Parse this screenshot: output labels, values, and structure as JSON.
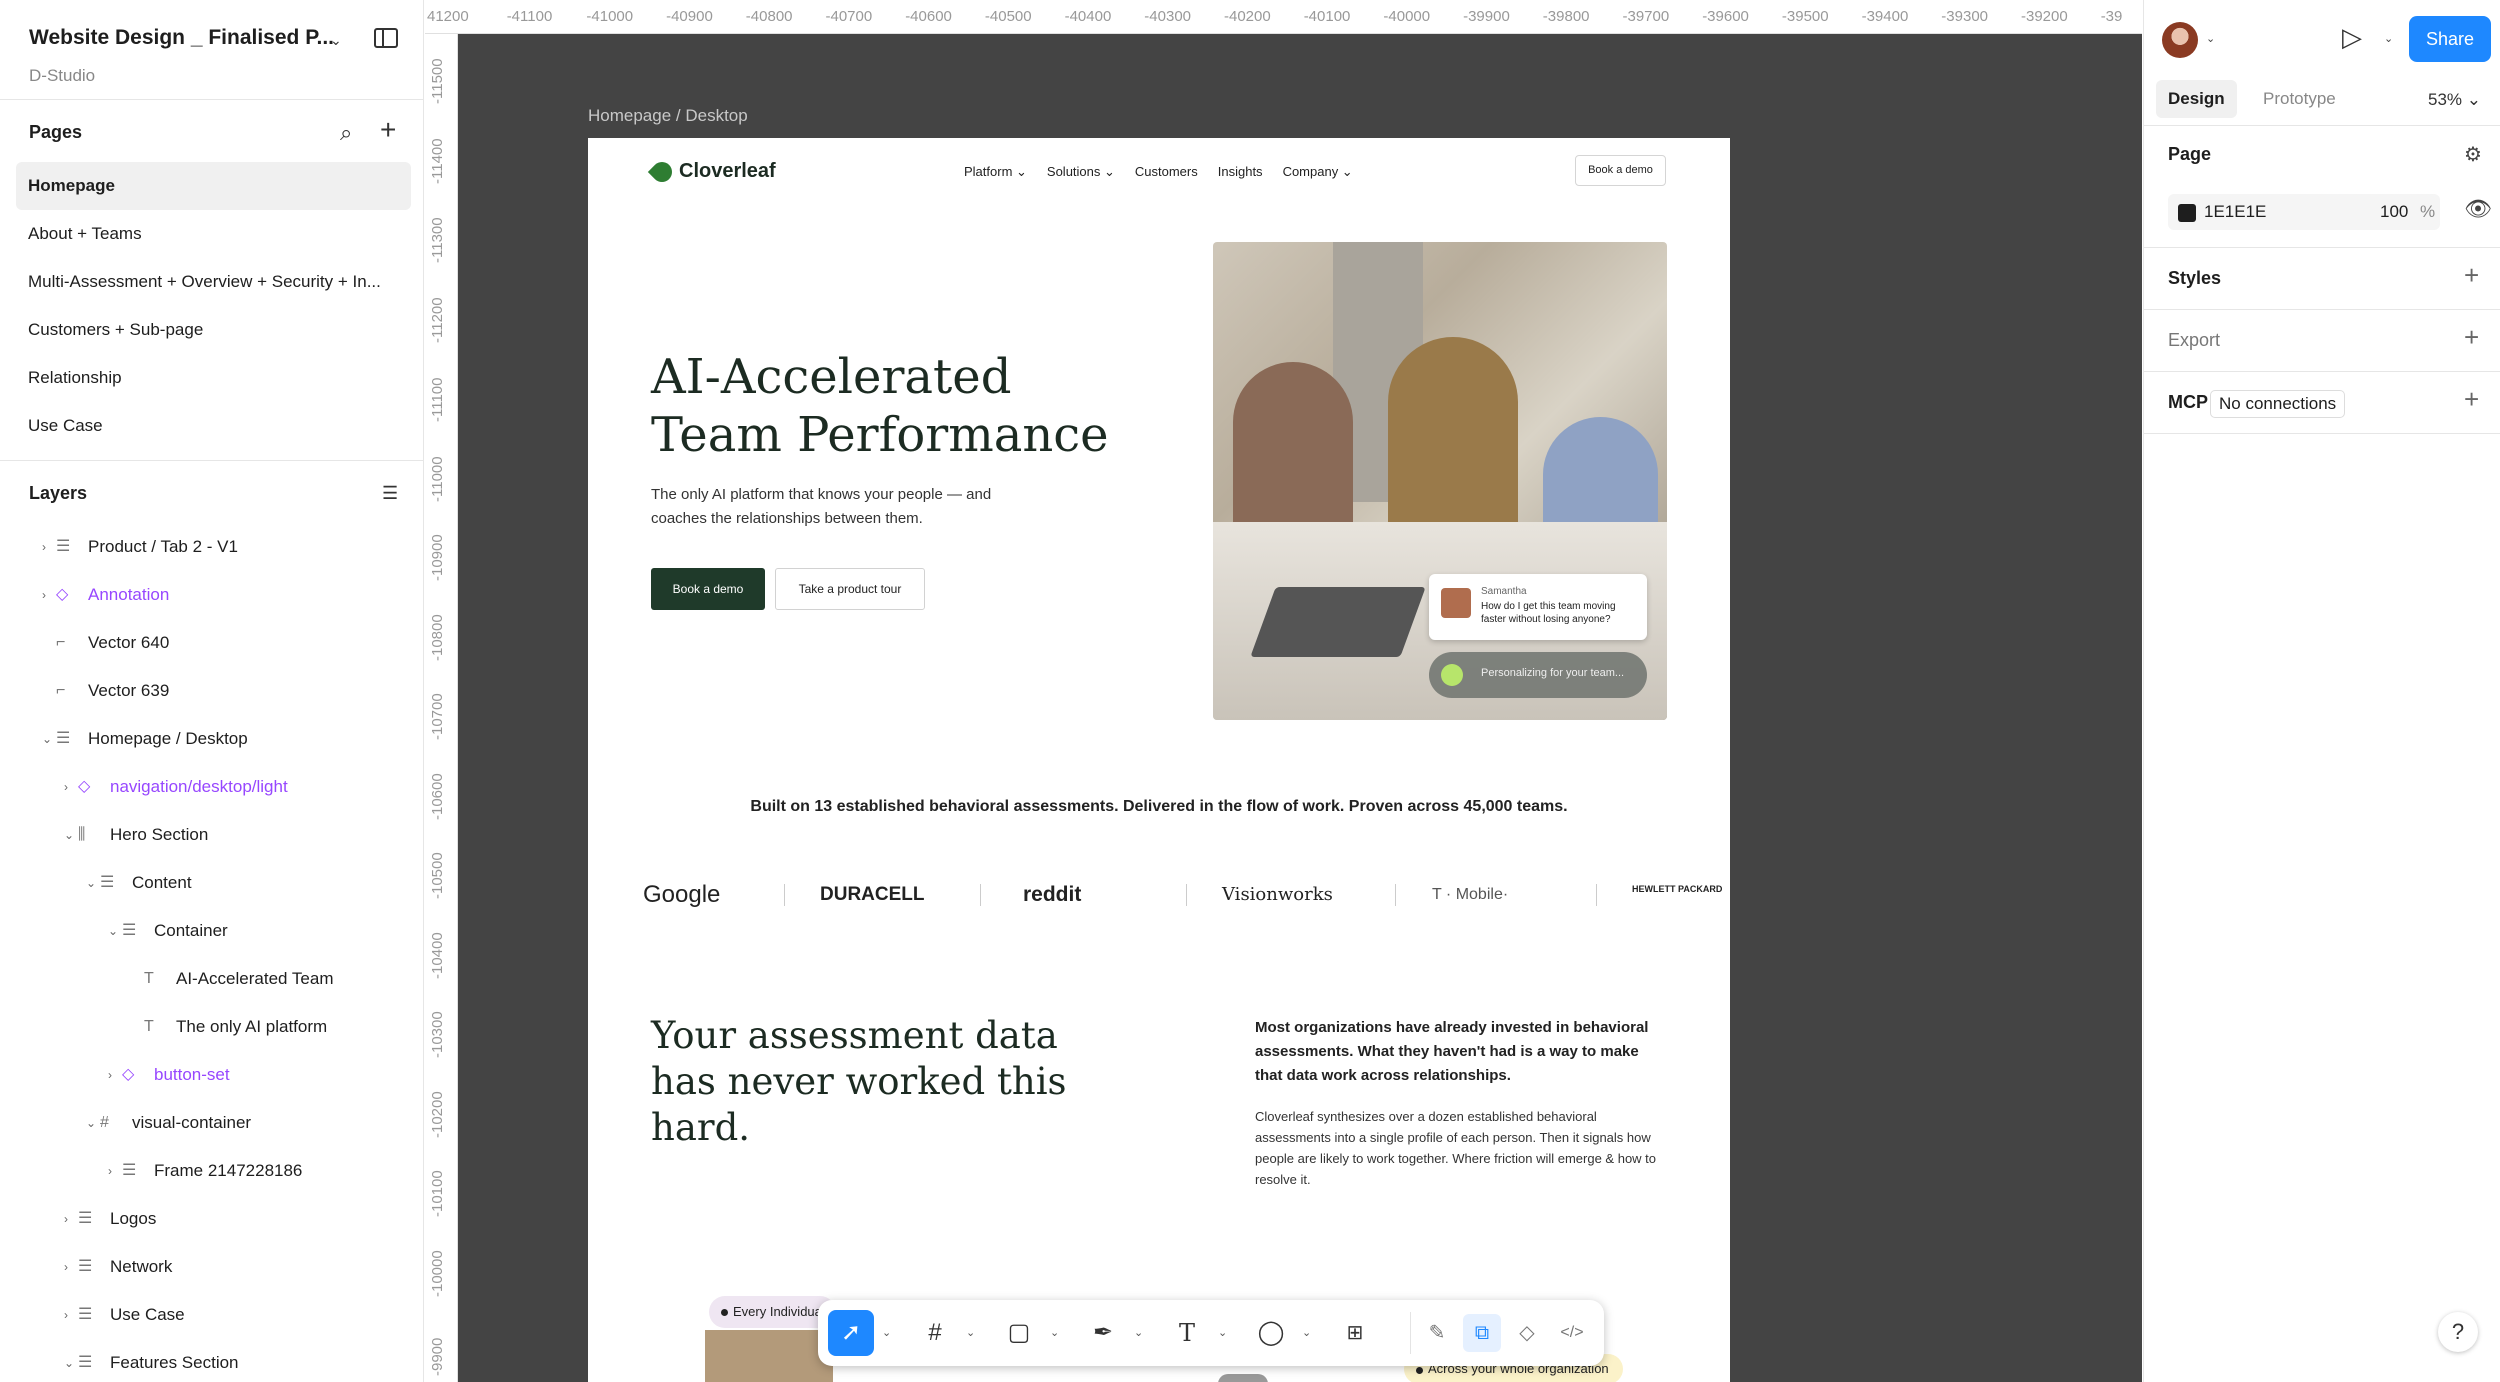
{
  "file": {
    "title": "Website Design _ Finalised P...",
    "team": "D-Studio"
  },
  "pages": {
    "heading": "Pages",
    "items": [
      {
        "label": "Homepage",
        "active": true
      },
      {
        "label": "About + Teams"
      },
      {
        "label": "Multi-Assessment + Overview + Security + In..."
      },
      {
        "label": "Customers + Sub-page"
      },
      {
        "label": "Relationship"
      },
      {
        "label": "Use Case"
      }
    ]
  },
  "layers": {
    "heading": "Layers",
    "items": [
      {
        "label": "Product / Tab 2 - V1",
        "icon": "frame-row-icon",
        "chevron": "right",
        "component": false
      },
      {
        "label": "Annotation",
        "icon": "component-icon",
        "chevron": "right",
        "component": true
      },
      {
        "label": "Vector 640",
        "icon": "vector-icon",
        "chevron": "",
        "component": false
      },
      {
        "label": "Vector 639",
        "icon": "vector-icon",
        "chevron": "",
        "component": false
      },
      {
        "label": "Homepage / Desktop",
        "icon": "frame-row-icon",
        "chevron": "down",
        "component": false
      },
      {
        "label": "navigation/desktop/light",
        "icon": "component-icon",
        "chevron": "right",
        "component": true
      },
      {
        "label": "Hero Section",
        "icon": "auto-layout-icon",
        "chevron": "down",
        "component": false
      },
      {
        "label": "Content",
        "icon": "frame-row-icon",
        "chevron": "down",
        "component": false
      },
      {
        "label": "Container",
        "icon": "frame-row-icon",
        "chevron": "down",
        "component": false
      },
      {
        "label": "AI-Accelerated Team",
        "icon": "text-icon",
        "chevron": "",
        "component": false
      },
      {
        "label": "The only AI platform",
        "icon": "text-icon",
        "chevron": "",
        "component": false
      },
      {
        "label": "button-set",
        "icon": "component-icon",
        "chevron": "right",
        "component": true
      },
      {
        "label": "visual-container",
        "icon": "frame-icon",
        "chevron": "down",
        "component": false
      },
      {
        "label": "Frame 2147228186",
        "icon": "frame-row-icon",
        "chevron": "right",
        "component": false
      },
      {
        "label": "Logos",
        "icon": "frame-row-icon",
        "chevron": "right",
        "component": false
      },
      {
        "label": "Network",
        "icon": "frame-row-icon",
        "chevron": "right",
        "component": false
      },
      {
        "label": "Use Case",
        "icon": "frame-row-icon",
        "chevron": "right",
        "component": false
      },
      {
        "label": "Features Section",
        "icon": "frame-row-icon",
        "chevron": "down",
        "component": false
      }
    ]
  },
  "ruler": {
    "top": [
      "41200",
      "-41100",
      "-41000",
      "-40900",
      "-40800",
      "-40700",
      "-40600",
      "-40500",
      "-40400",
      "-40300",
      "-40200",
      "-40100",
      "-40000",
      "-39900",
      "-39800",
      "-39700",
      "-39600",
      "-39500",
      "-39400",
      "-39300",
      "-39200",
      "-39"
    ],
    "left": [
      "-11500",
      "-11400",
      "-11300",
      "-11200",
      "-11100",
      "-11000",
      "-10900",
      "-10800",
      "-10700",
      "-10600",
      "-10500",
      "-10400",
      "-10300",
      "-10200",
      "-10100",
      "-10000",
      "-9900"
    ]
  },
  "frame_label": "Homepage / Desktop",
  "site": {
    "brand": "Cloverleaf",
    "nav": [
      "Platform ⌄",
      "Solutions ⌄",
      "Customers",
      "Insights",
      "Company ⌄"
    ],
    "nav_cta": "Book a demo",
    "hero_title": "AI-Accelerated Team Performance",
    "hero_sub": "The only AI platform that knows your people — and coaches the relationships between them.",
    "primary_cta": "Book a demo",
    "secondary_cta": "Take a product tour",
    "chat_name": "Samantha",
    "chat_msg": "How do I get this team moving faster without losing anyone?",
    "personalizing": "Personalizing for your team...",
    "built_line": "Built on 13 established behavioral assessments. Delivered in the flow of work. Proven across 45,000 teams.",
    "logos": [
      "Google",
      "DURACELL",
      "reddit",
      "Visionworks",
      "T · Mobile·",
      "HEWLETT PACKARD"
    ],
    "assess_title": "Your assessment data has never worked this hard.",
    "assess_lead": "Most organizations have already invested in behavioral assessments. What they haven't had is a way to make that data work across relationships.",
    "assess_body": "Cloverleaf synthesizes over a dozen established behavioral assessments into a single profile of each person. Then it signals how people are likely to work together. Where friction will emerge & how to resolve it.",
    "tag1": "Every Individua",
    "tag2": "Across your whole organization"
  },
  "toolbar": {
    "tools": [
      "move-tool",
      "frame-tool",
      "shape-tool",
      "pen-tool",
      "text-tool",
      "comment-tool",
      "actions-tool"
    ],
    "modes": [
      "draw-mode",
      "design-mode",
      "dev-component-mode",
      "dev-mode"
    ]
  },
  "right": {
    "share": "Share",
    "tabs": [
      "Design",
      "Prototype"
    ],
    "zoom": "53% ⌄",
    "page_heading": "Page",
    "page_color": "1E1E1E",
    "page_opacity": "100",
    "pct": "%",
    "styles_heading": "Styles",
    "export_heading": "Export",
    "mcp_heading": "MCP",
    "mcp_value": "No connections",
    "help": "?"
  },
  "colors": {
    "accent": "#1e88ff",
    "component": "#9747ff",
    "canvas": "#444444",
    "brand_green": "#1f3a2a"
  }
}
